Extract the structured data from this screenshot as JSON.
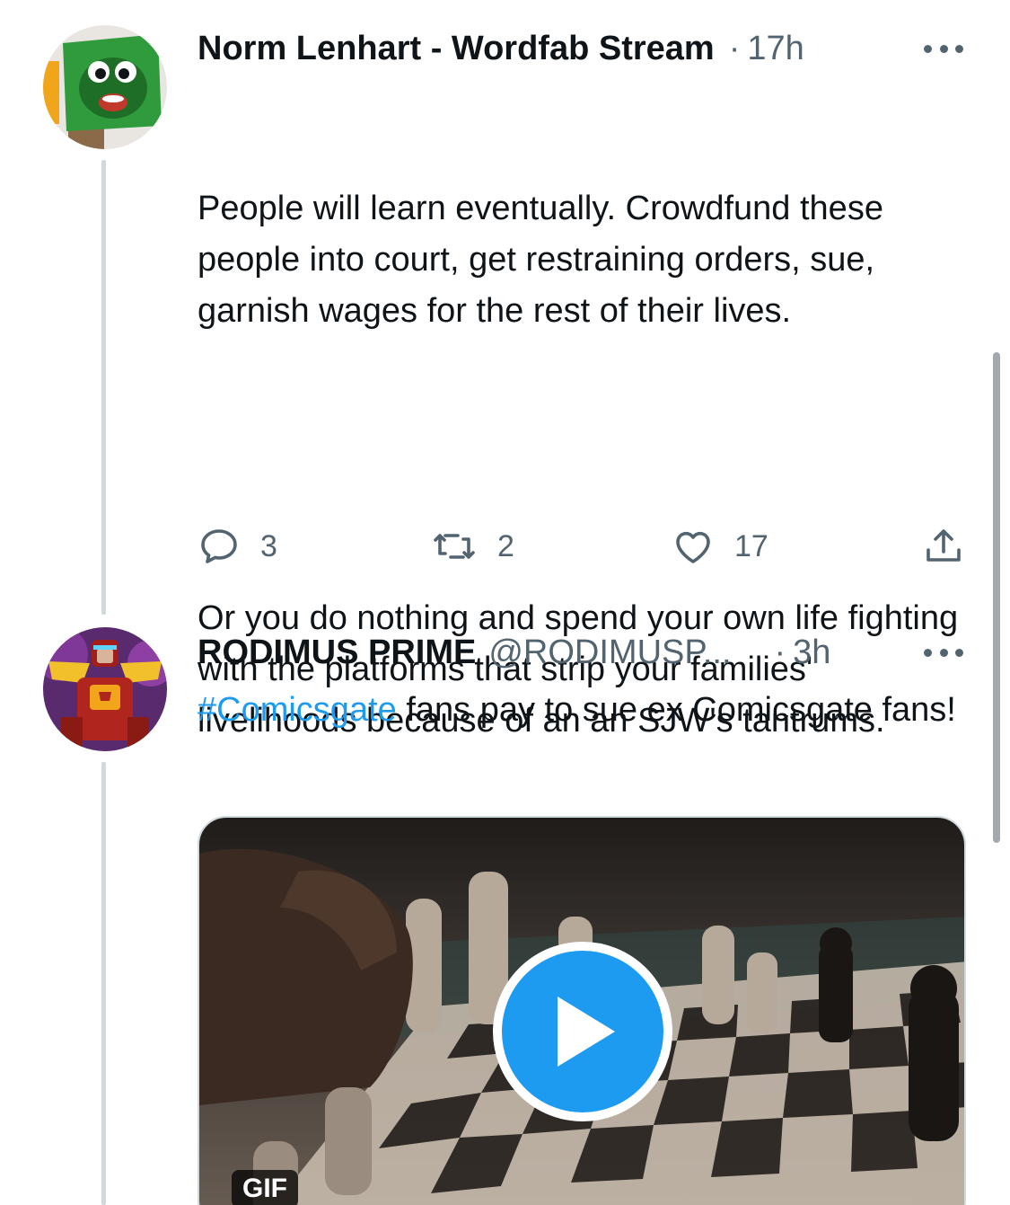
{
  "tweets": [
    {
      "name": "Norm Lenhart - Wordfab Stream",
      "handle": "",
      "dot": "·",
      "time": "17h",
      "paragraph_1": "People will learn eventually. Crowdfund these people into court, get restraining orders, sue, garnish wages for the rest of their lives.",
      "paragraph_2": "Or you do nothing and spend your own life fighting with the platforms that strip your families' livelihoods because of an an SJW's tantrums.",
      "replies": "3",
      "retweets": "2",
      "likes": "17",
      "avatar_icon": "frog-avatar-icon"
    },
    {
      "name": "RODIMUS PRIME",
      "handle": "@RODIMUSP...",
      "dot": "·",
      "time": "3h",
      "hashtag": "#Comicsgate",
      "text_rest": " fans pay to sue ex Comicsgate fans!",
      "media_badge": "GIF",
      "avatar_icon": "robot-avatar-icon"
    }
  ],
  "colors": {
    "text": "#0f1419",
    "secondary": "#536471",
    "accent": "#1d9bf0",
    "thread_line": "#cfd9de"
  },
  "icons": [
    "reply-icon",
    "retweet-icon",
    "like-icon",
    "share-icon",
    "more-icon",
    "play-icon"
  ]
}
